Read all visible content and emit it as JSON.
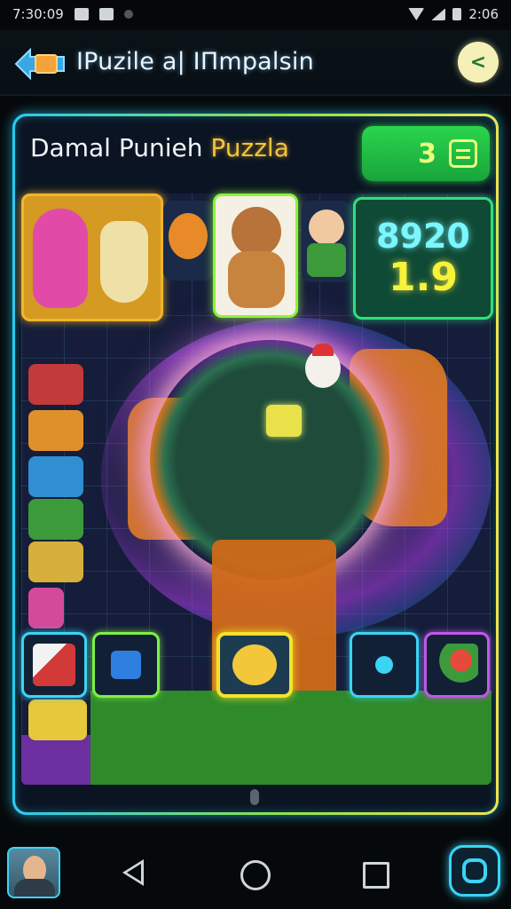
{
  "status_bar": {
    "time_left": "7:30:09",
    "time_right": "2:06"
  },
  "app_bar": {
    "title": "IPuzile a| IΠmpalsin",
    "back_label": "<"
  },
  "board": {
    "header_white": "Damal Punieh",
    "header_yellow": "Puzzla",
    "level": "3",
    "score_top": "8920",
    "score_bottom": "1.9"
  },
  "colors": {
    "frame_cyan": "#29c9f2",
    "badge_green": "#2bd44e",
    "score_cyan": "#7af7ff",
    "score_yellow": "#f7f23a",
    "accent_orange": "#f5c33a"
  }
}
